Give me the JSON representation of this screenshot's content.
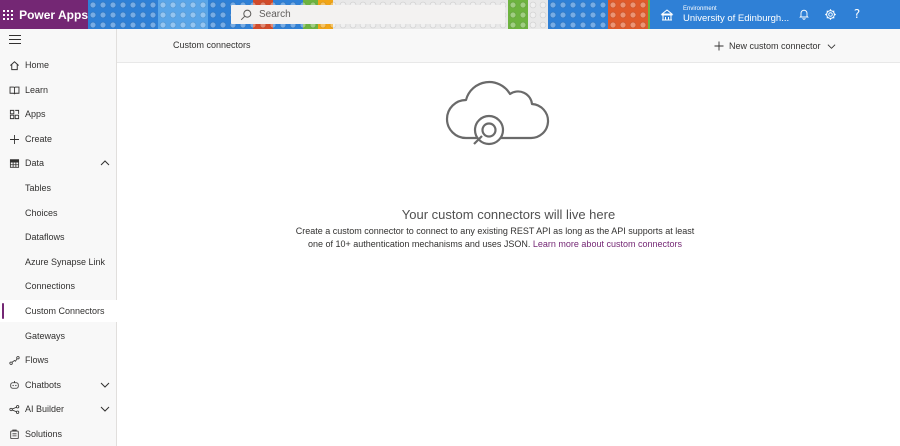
{
  "app": {
    "name": "Power Apps"
  },
  "search": {
    "placeholder": "Search"
  },
  "environment": {
    "label": "Environment",
    "name": "University of Edinburgh..."
  },
  "sidebar": {
    "items": [
      {
        "key": "home",
        "label": "Home",
        "icon": "home-icon"
      },
      {
        "key": "learn",
        "label": "Learn",
        "icon": "book-icon"
      },
      {
        "key": "apps",
        "label": "Apps",
        "icon": "apps-icon"
      },
      {
        "key": "create",
        "label": "Create",
        "icon": "plus-icon"
      },
      {
        "key": "data",
        "label": "Data",
        "icon": "table-icon",
        "expanded": true
      },
      {
        "key": "tables",
        "label": "Tables",
        "sub": true
      },
      {
        "key": "choices",
        "label": "Choices",
        "sub": true
      },
      {
        "key": "dataflows",
        "label": "Dataflows",
        "sub": true
      },
      {
        "key": "azure-synapse-link",
        "label": "Azure Synapse Link",
        "sub": true
      },
      {
        "key": "connections",
        "label": "Connections",
        "sub": true
      },
      {
        "key": "custom-connectors",
        "label": "Custom Connectors",
        "sub": true,
        "selected": true
      },
      {
        "key": "gateways",
        "label": "Gateways",
        "sub": true
      },
      {
        "key": "flows",
        "label": "Flows",
        "icon": "flow-icon"
      },
      {
        "key": "chatbots",
        "label": "Chatbots",
        "icon": "chatbot-icon",
        "expandable": true
      },
      {
        "key": "ai-builder",
        "label": "AI Builder",
        "icon": "ai-builder-icon",
        "expandable": true
      },
      {
        "key": "solutions",
        "label": "Solutions",
        "icon": "solutions-icon"
      }
    ]
  },
  "commandbar": {
    "title": "Custom connectors",
    "new_label": "New custom connector"
  },
  "empty_state": {
    "title": "Your custom connectors will live here",
    "description": "Create a custom connector to connect to any existing REST API as long as the API supports at least one of 10+ authentication mechanisms and uses JSON.",
    "link": "Learn more about custom connectors"
  },
  "colors": {
    "brand": "#742774",
    "accent_link": "#742774",
    "sidebar_bg": "#f8f8f8"
  }
}
